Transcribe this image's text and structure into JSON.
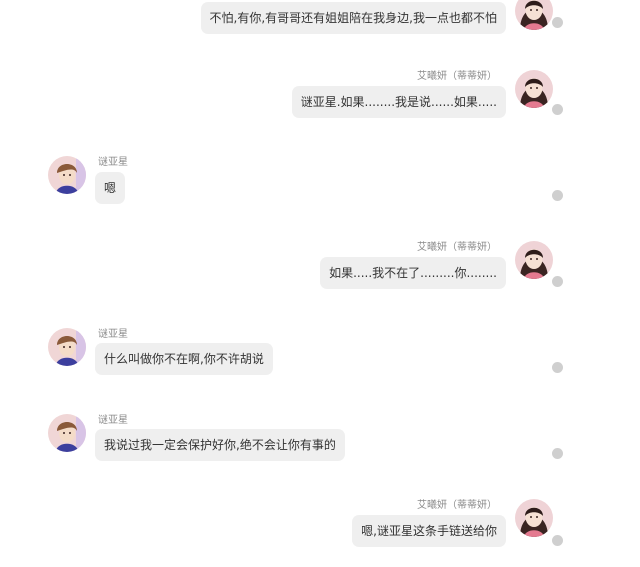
{
  "users": {
    "female": {
      "name": "艾曦妍（蒂蒂妍）",
      "avatar_icon": "girl-avatar-icon"
    },
    "male": {
      "name": "谜亚星",
      "avatar_icon": "boy-avatar-icon"
    }
  },
  "messages": [
    {
      "side": "right",
      "name": "",
      "text": "不怕,有你,有哥哥还有姐姐陪在我身边,我一点也都不怕"
    },
    {
      "side": "right",
      "name": "艾曦妍（蒂蒂妍）",
      "text": "谜亚星.如果........我是说......如果....."
    },
    {
      "side": "left",
      "name": "谜亚星",
      "text": "嗯"
    },
    {
      "side": "right",
      "name": "艾曦妍（蒂蒂妍）",
      "text": "如果.....我不在了.........你........"
    },
    {
      "side": "left",
      "name": "谜亚星",
      "text": "什么叫做你不在啊,你不许胡说"
    },
    {
      "side": "left",
      "name": "谜亚星",
      "text": "我说过我一定会保护好你,绝不会让你有事的"
    },
    {
      "side": "right",
      "name": "艾曦妍（蒂蒂妍）",
      "text": "嗯,谜亚星这条手链送给你"
    }
  ],
  "colors": {
    "bubble_bg": "#efefef",
    "status_dot": "#cfcfcf",
    "name_text": "#8c8c8c",
    "message_text": "#333333"
  }
}
